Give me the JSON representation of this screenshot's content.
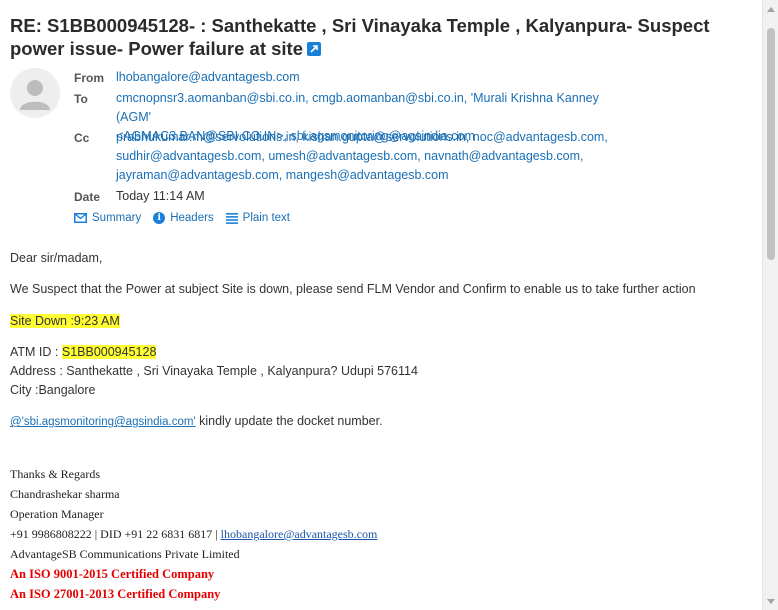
{
  "subject": "RE: S1BB000945128- : Santhekatte , Sri Vinayaka Temple , Kalyanpura- Suspect power issue- Power failure at site",
  "header": {
    "from_label": "From",
    "from_value": "lhobangalore@advantagesb.com",
    "to_label": "To",
    "to_line1": "cmcnopnsr3.aomanban@sbi.co.in, cmgb.aomanban@sbi.co.in, 'Murali Krishna Kanney (AGM'",
    "to_line2": "<AGMAC3.BAN@SBI.CO.IN>, sbi.agsmonitoring@agsindia.com",
    "cc_label": "Cc",
    "cc_line1": "prabhukumar.m@servolutions.in, kishan.gupta@servolutions.in, noc@advantagesb.com,",
    "cc_line2": "sudhir@advantagesb.com, umesh@advantagesb.com, navnath@advantagesb.com,",
    "cc_line3": "jayraman@advantagesb.com, mangesh@advantagesb.com",
    "date_label": "Date",
    "date_value": "Today 11:14 AM"
  },
  "view_links": {
    "summary": "Summary",
    "headers": "Headers",
    "plain_text": "Plain text"
  },
  "body": {
    "greeting": "Dear sir/madam,",
    "line1": "We Suspect that the Power at subject Site is down, please send FLM Vendor and Confirm to enable us to take further action",
    "site_down": "Site Down :9:23 AM",
    "atm_label": "ATM ID : ",
    "atm_value": "S1BB000945128",
    "address": "Address : Santhekatte , Sri Vinayaka Temple , Kalyanpura? Udupi 576114",
    "city": "City :Bangalore",
    "mention_link": "@'sbi.agsmonitoring@agsindia.com'",
    "mention_rest": " kindly update the docket number."
  },
  "signature": {
    "thanks": "Thanks & Regards",
    "name": "Chandrashekar sharma",
    "title": "Operation Manager",
    "phone": "+91 9986808222 | DID +91 22 6831 6817 |  ",
    "email": "lhobangalore@advantagesb.com",
    "company": "AdvantageSB Communications Private Limited",
    "iso1": "An ISO 9001-2015 Certified Company",
    "iso2": "An ISO 27001-2013 Certified Company"
  },
  "colors": {
    "link": "#1a6fb5",
    "highlight": "#ffff33",
    "iso_red": "#e60000"
  }
}
